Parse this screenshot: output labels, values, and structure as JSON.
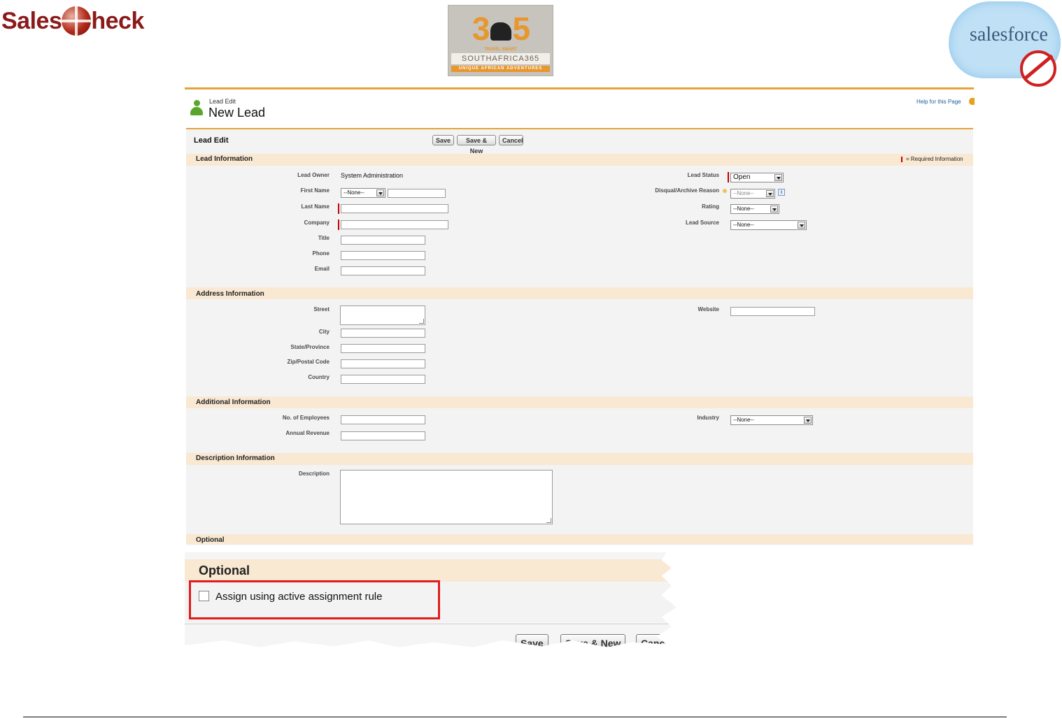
{
  "logos": {
    "salescheck_left": "Sales",
    "salescheck_right": "heck",
    "sa365_num_left": "3",
    "sa365_num_right": "5",
    "sa365_tag1": "TRAVEL SMART",
    "sa365_brand": "SOUTHAFRICA365",
    "sa365_tagline": "UNIQUE AFRICAN ADVENTURES",
    "salesforce_word": "salesforce"
  },
  "header": {
    "breadcrumb": "Lead Edit",
    "title": "New Lead",
    "help_link": "Help for this Page"
  },
  "edit_block": {
    "title": "Lead Edit",
    "buttons": {
      "save": "Save",
      "save_new": "Save & New",
      "cancel": "Cancel"
    },
    "required_legend": "= Required Information"
  },
  "sections": {
    "lead_info": {
      "title": "Lead Information",
      "lead_owner_label": "Lead Owner",
      "lead_owner_value": "System Administration",
      "first_name_label": "First Name",
      "salutation_value": "--None--",
      "last_name_label": "Last Name",
      "company_label": "Company",
      "title_label": "Title",
      "phone_label": "Phone",
      "email_label": "Email",
      "lead_status_label": "Lead Status",
      "lead_status_value": "Open",
      "disqual_label": "Disqual/Archive Reason",
      "disqual_value": "--None--",
      "info_icon": "i",
      "rating_label": "Rating",
      "rating_value": "--None--",
      "lead_source_label": "Lead Source",
      "lead_source_value": "--None--"
    },
    "address_info": {
      "title": "Address Information",
      "street_label": "Street",
      "city_label": "City",
      "state_label": "State/Province",
      "zip_label": "Zip/Postal Code",
      "country_label": "Country",
      "website_label": "Website"
    },
    "additional_info": {
      "title": "Additional Information",
      "employees_label": "No. of Employees",
      "revenue_label": "Annual Revenue",
      "industry_label": "Industry",
      "industry_value": "--None--"
    },
    "description_info": {
      "title": "Description Information",
      "description_label": "Description"
    },
    "optional": {
      "title": "Optional"
    }
  },
  "zoom_callout": {
    "title": "Optional",
    "checkbox_label": "Assign using active assignment rule",
    "save": "Save",
    "save_new": "Save & New",
    "cancel": "Canc"
  },
  "colors": {
    "accent_orange": "#e5a33a",
    "section_bar": "#f9e8d2",
    "required_red": "#c00000",
    "highlight_red": "#e01c1c",
    "salescheck_red": "#8b1a1a"
  }
}
